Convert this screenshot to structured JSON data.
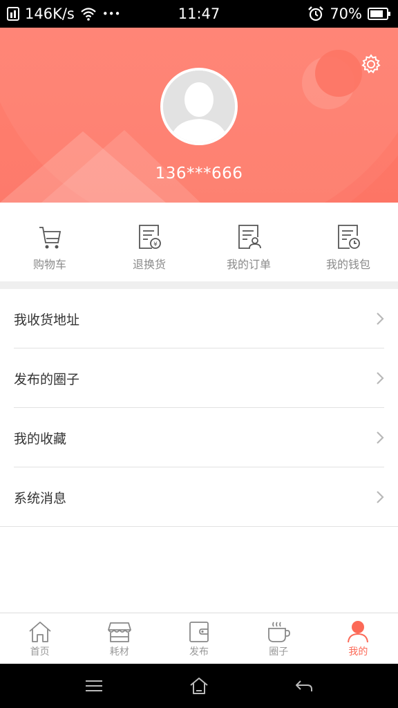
{
  "status_bar": {
    "speed": "146K/s",
    "dots": "•••",
    "time": "11:47",
    "battery": "70%"
  },
  "header": {
    "phone": "136***666",
    "accent": "#fd7565"
  },
  "quick_actions": [
    {
      "label": "购物车",
      "icon": "cart-icon"
    },
    {
      "label": "退换货",
      "icon": "return-icon"
    },
    {
      "label": "我的订单",
      "icon": "order-icon"
    },
    {
      "label": "我的钱包",
      "icon": "wallet-icon"
    }
  ],
  "menu": [
    {
      "label": "我收货地址"
    },
    {
      "label": "发布的圈子"
    },
    {
      "label": "我的收藏"
    },
    {
      "label": "系统消息"
    }
  ],
  "tabs": [
    {
      "label": "首页",
      "icon": "home-icon"
    },
    {
      "label": "耗材",
      "icon": "store-icon"
    },
    {
      "label": "发布",
      "icon": "publish-icon"
    },
    {
      "label": "圈子",
      "icon": "cup-icon"
    },
    {
      "label": "我的",
      "icon": "person-icon",
      "active": true
    }
  ]
}
